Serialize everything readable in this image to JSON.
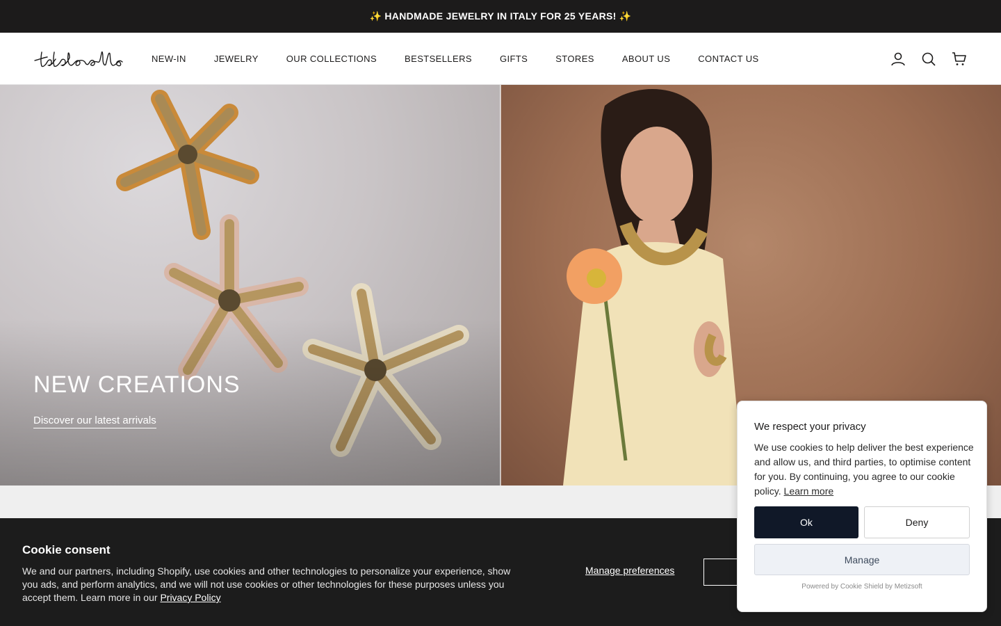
{
  "announcement": {
    "text": "✨ HANDMADE JEWELRY IN ITALY FOR 25 YEARS! ✨"
  },
  "header": {
    "logo_text": "tatabonello",
    "nav": [
      {
        "label": "NEW-IN"
      },
      {
        "label": "JEWELRY"
      },
      {
        "label": "OUR COLLECTIONS"
      },
      {
        "label": "BESTSELLERS"
      },
      {
        "label": "GIFTS"
      },
      {
        "label": "STORES"
      },
      {
        "label": "ABOUT US"
      },
      {
        "label": "CONTACT US"
      }
    ],
    "icons": [
      "account-icon",
      "search-icon",
      "cart-icon"
    ]
  },
  "hero": {
    "title": "NEW CREATIONS",
    "link_label": "Discover our latest arrivals",
    "left_image": "beaded-starfish-bracelet-image",
    "right_image": "model-with-flower-image"
  },
  "consent_bar": {
    "title": "Cookie consent",
    "text_before": "We and our partners, including Shopify, use cookies and other technologies to personalize your experience, show you ads, and perform analytics, and we will not use cookies or other technologies for these purposes unless you accept them. Learn more in our ",
    "privacy_link": "Privacy Policy",
    "manage_label": "Manage preferences"
  },
  "privacy_popup": {
    "title": "We respect your privacy",
    "text": "We use cookies to help deliver the best experience and allow us, and third parties, to optimise content for you. By continuing, you agree to our cookie policy. ",
    "learn_more": "Learn more",
    "ok_label": "Ok",
    "deny_label": "Deny",
    "manage_label": "Manage",
    "powered_by": "Powered by Cookie Shield by Metizsoft"
  },
  "colors": {
    "dark": "#1c1b1b",
    "ok_button": "#101828",
    "manage_bg": "#eef1f6"
  }
}
